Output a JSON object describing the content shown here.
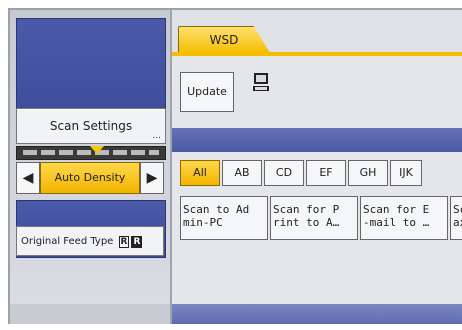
{
  "left_panel": {
    "scan_settings_label": "Scan Settings",
    "scan_settings_more": "...",
    "density": {
      "left_arrow": "◀",
      "auto_label": "Auto Density",
      "right_arrow": "▶"
    },
    "original_feed_label": "Original Feed Type",
    "original_feed_more": "..."
  },
  "right_panel": {
    "tab_label": "WSD",
    "update_label": "Update",
    "pc_icon": "computer-icon",
    "filters": [
      "All",
      "AB",
      "CD",
      "EF",
      "GH",
      "IJK"
    ],
    "destinations": [
      "Scan to Ad\nmin-PC",
      "Scan for P\nrint to A…",
      "Scan for E\n-mail to …",
      "Sc\nax"
    ]
  },
  "colors": {
    "accent_yellow": "#f5be00",
    "panel_blue": "#4a5aa9"
  }
}
